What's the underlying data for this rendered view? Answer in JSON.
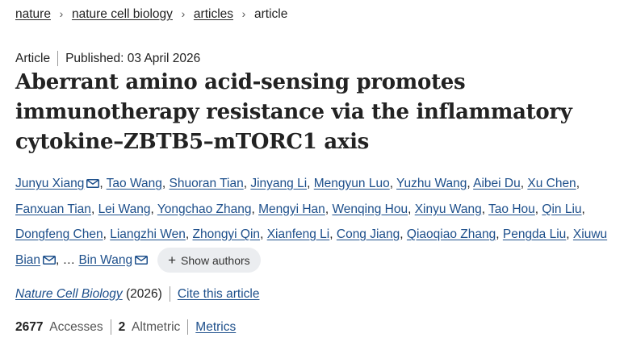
{
  "breadcrumb": {
    "items": [
      "nature",
      "nature cell biology",
      "articles"
    ],
    "current": "article",
    "separator": "›"
  },
  "meta": {
    "type": "Article",
    "published": "Published: 03 April 2026"
  },
  "title": "Aberrant amino acid-sensing promotes immunotherapy resistance via the inflammatory cytokine–ZBTB5–mTORC1 axis",
  "authors": [
    {
      "name": "Junyu Xiang",
      "mail": true
    },
    {
      "name": "Tao Wang"
    },
    {
      "name": "Shuoran Tian"
    },
    {
      "name": "Jinyang Li"
    },
    {
      "name": "Mengyun Luo"
    },
    {
      "name": "Yuzhu Wang"
    },
    {
      "name": "Aibei Du"
    },
    {
      "name": "Xu Chen"
    },
    {
      "name": "Fanxuan Tian"
    },
    {
      "name": "Lei Wang"
    },
    {
      "name": "Yongchao Zhang"
    },
    {
      "name": "Mengyi Han"
    },
    {
      "name": "Wenqing Hou"
    },
    {
      "name": "Xinyu Wang"
    },
    {
      "name": "Tao Hou"
    },
    {
      "name": "Qin Liu"
    },
    {
      "name": "Dongfeng Chen"
    },
    {
      "name": "Liangzhi Wen"
    },
    {
      "name": "Zhongyi Qin"
    },
    {
      "name": "Xianfeng Li"
    },
    {
      "name": "Cong Jiang"
    },
    {
      "name": "Qiaoqiao Zhang"
    },
    {
      "name": "Pengda Liu"
    },
    {
      "name": "Xiuwu Bian",
      "mail": true
    },
    {
      "name": "Bin Wang",
      "mail": true
    }
  ],
  "authors_ellipsis": "…",
  "show_authors_label": "Show authors",
  "journal": {
    "name": "Nature Cell Biology",
    "year": "(2026)",
    "cite": "Cite this article"
  },
  "metrics": {
    "accesses_count": "2677",
    "accesses_label": "Accesses",
    "altmetric_count": "2",
    "altmetric_label": "Altmetric",
    "metrics_link": "Metrics"
  },
  "colors": {
    "link": "#1d4f8b",
    "text": "#222222",
    "button_bg": "#ebedf0"
  }
}
